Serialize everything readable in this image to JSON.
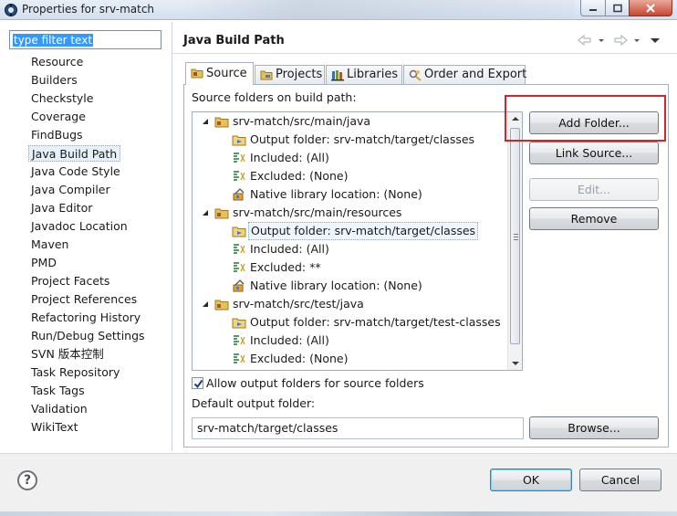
{
  "window": {
    "title": "Properties for srv-match",
    "title_icon": "properties-icon"
  },
  "filter": {
    "value": "type filter text"
  },
  "nav": {
    "items": [
      "Resource",
      "Builders",
      "Checkstyle",
      "Coverage",
      "FindBugs",
      "Java Build Path",
      "Java Code Style",
      "Java Compiler",
      "Java Editor",
      "Javadoc Location",
      "Maven",
      "PMD",
      "Project Facets",
      "Project References",
      "Refactoring History",
      "Run/Debug Settings",
      "SVN 版本控制",
      "Task Repository",
      "Task Tags",
      "Validation",
      "WikiText"
    ],
    "selected": "Java Build Path"
  },
  "page": {
    "title": "Java Build Path"
  },
  "tabs": [
    {
      "label": "Source",
      "icon": "source-folder-icon",
      "active": true
    },
    {
      "label": "Projects",
      "icon": "projects-icon",
      "active": false
    },
    {
      "label": "Libraries",
      "icon": "libraries-icon",
      "active": false
    },
    {
      "label": "Order and Export",
      "icon": "order-export-icon",
      "active": false
    }
  ],
  "source": {
    "folders_label": "Source folders on build path:",
    "tree": [
      {
        "text": "srv-match/src/main/java",
        "level": 0,
        "icon": "package-folder-icon",
        "expanded": true
      },
      {
        "text": "Output folder: srv-match/target/classes",
        "level": 1,
        "icon": "output-folder-icon"
      },
      {
        "text": "Included: (All)",
        "level": 1,
        "icon": "filter-icon"
      },
      {
        "text": "Excluded: (None)",
        "level": 1,
        "icon": "filter-icon"
      },
      {
        "text": "Native library location: (None)",
        "level": 1,
        "icon": "native-library-icon"
      },
      {
        "text": "srv-match/src/main/resources",
        "level": 0,
        "icon": "package-folder-icon",
        "expanded": true
      },
      {
        "text": "Output folder: srv-match/target/classes",
        "level": 1,
        "icon": "output-folder-icon",
        "selected": true
      },
      {
        "text": "Included: (All)",
        "level": 1,
        "icon": "filter-icon"
      },
      {
        "text": "Excluded: **",
        "level": 1,
        "icon": "filter-icon"
      },
      {
        "text": "Native library location: (None)",
        "level": 1,
        "icon": "native-library-icon"
      },
      {
        "text": "srv-match/src/test/java",
        "level": 0,
        "icon": "package-folder-icon",
        "expanded": true
      },
      {
        "text": "Output folder: srv-match/target/test-classes",
        "level": 1,
        "icon": "output-folder-icon"
      },
      {
        "text": "Included: (All)",
        "level": 1,
        "icon": "filter-icon"
      },
      {
        "text": "Excluded: (None)",
        "level": 1,
        "icon": "filter-icon"
      }
    ],
    "buttons": {
      "add_folder": "Add Folder...",
      "link_source": "Link Source...",
      "edit": "Edit...",
      "remove": "Remove"
    },
    "allow_output_label": "Allow output folders for source folders",
    "allow_output_checked": true,
    "default_output_label": "Default output folder:",
    "default_output_value": "srv-match/target/classes",
    "browse": "Browse..."
  },
  "footer": {
    "ok": "OK",
    "cancel": "Cancel",
    "help_icon": "help-icon"
  },
  "colors": {
    "selection": "#3399ff",
    "highlight_box": "#d0262b",
    "default_button_border": "#3c7fb1"
  }
}
